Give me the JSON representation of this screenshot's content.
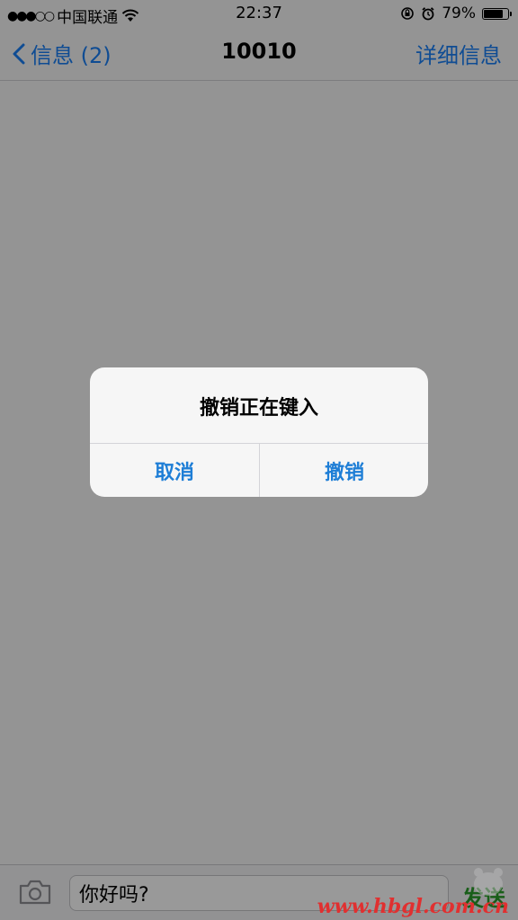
{
  "status_bar": {
    "signal": "●●●○○",
    "carrier": "中国联通",
    "time": "22:37",
    "battery_percent": "79%",
    "battery_level": 0.79
  },
  "nav": {
    "back_label": "信息 (2)",
    "title": "10010",
    "details_label": "详细信息"
  },
  "alert": {
    "title": "撤销正在键入",
    "cancel_label": "取消",
    "confirm_label": "撤销"
  },
  "composer": {
    "input_value": "你好吗?",
    "send_label": "发送"
  },
  "watermark": "www.hbgl.com.cn",
  "colors": {
    "accent": "#1a7ff5",
    "send": "#2a9d2a",
    "watermark": "#e03030"
  },
  "icons": [
    "wifi-icon",
    "orientation-lock-icon",
    "alarm-icon",
    "battery-icon",
    "back-chevron-icon",
    "camera-icon"
  ]
}
